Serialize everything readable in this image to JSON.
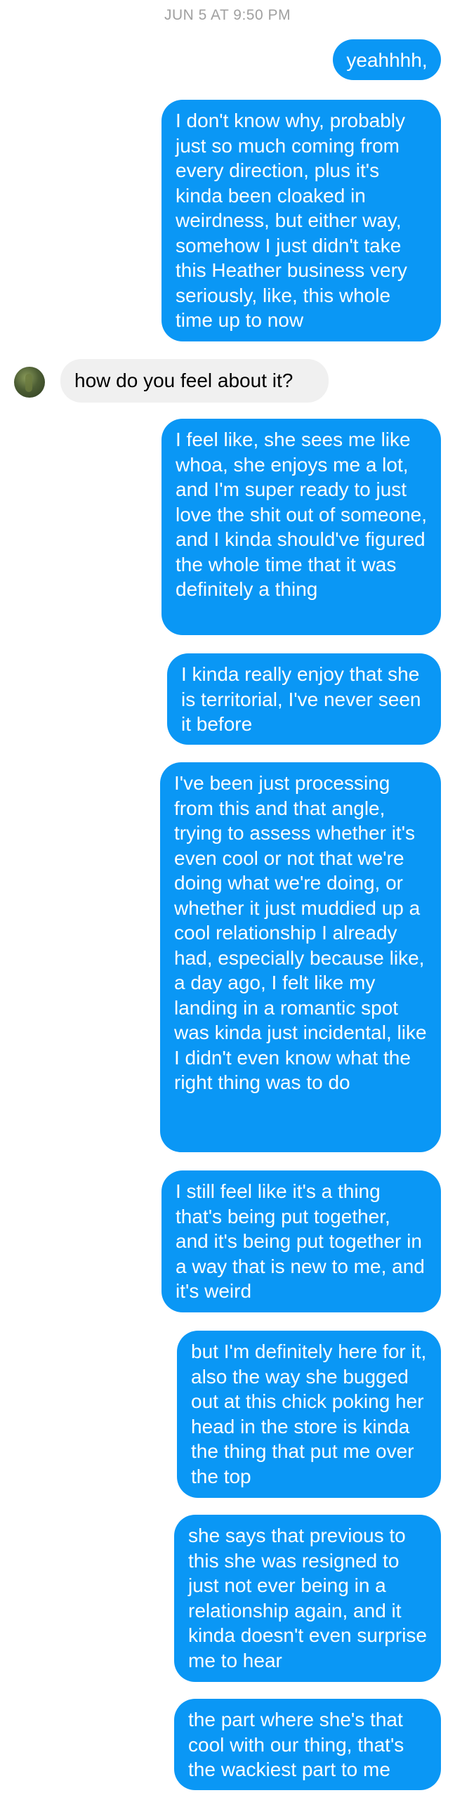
{
  "header": {
    "timestamp": "JUN 5 AT 9:50 PM"
  },
  "messages": [
    {
      "from": "me",
      "text": "yeahhhh,"
    },
    {
      "from": "me",
      "text": "I don't know why, probably just so much coming from every direction, plus it's kinda been cloaked in weirdness, but either way, somehow I just didn't take this Heather business very seriously, like, this whole time up to now"
    },
    {
      "from": "them",
      "text": "how do you feel about it?"
    },
    {
      "from": "me",
      "text": "I feel like, she sees me like whoa, she enjoys me a lot, and I'm super ready to just love the shit out of someone, and I kinda should've figured the whole time that it was definitely a thing"
    },
    {
      "from": "me",
      "text": "I kinda really enjoy that she is territorial, I've never seen it before"
    },
    {
      "from": "me",
      "text": "I've been just processing from this and that angle, trying to assess whether it's even cool or not that we're doing what we're doing, or whether it just muddied up a cool relationship I already had, especially because like, a day ago, I felt like my landing in a romantic spot was kinda just incidental, like I didn't even know what the right thing was to do"
    },
    {
      "from": "me",
      "text": "I still feel like it's a thing that's being put together, and it's being put together in a way that is new to me, and it's weird"
    },
    {
      "from": "me",
      "text": "but I'm definitely here for it, also the way she bugged out at this chick poking her head in the store is kinda the thing that put me over the top"
    },
    {
      "from": "me",
      "text": "she says that previous to this she was resigned to just not ever being in a relationship again, and it kinda doesn't even surprise me to hear"
    },
    {
      "from": "me",
      "text": "the part where she's that cool with our thing, that's the wackiest part to me"
    }
  ],
  "colors": {
    "sent_bubble": "#0a97f5",
    "received_bubble": "#f0f0f0",
    "timestamp_text": "#a0a0a0"
  },
  "icons": {
    "contact_avatar": "avatar-photo"
  }
}
